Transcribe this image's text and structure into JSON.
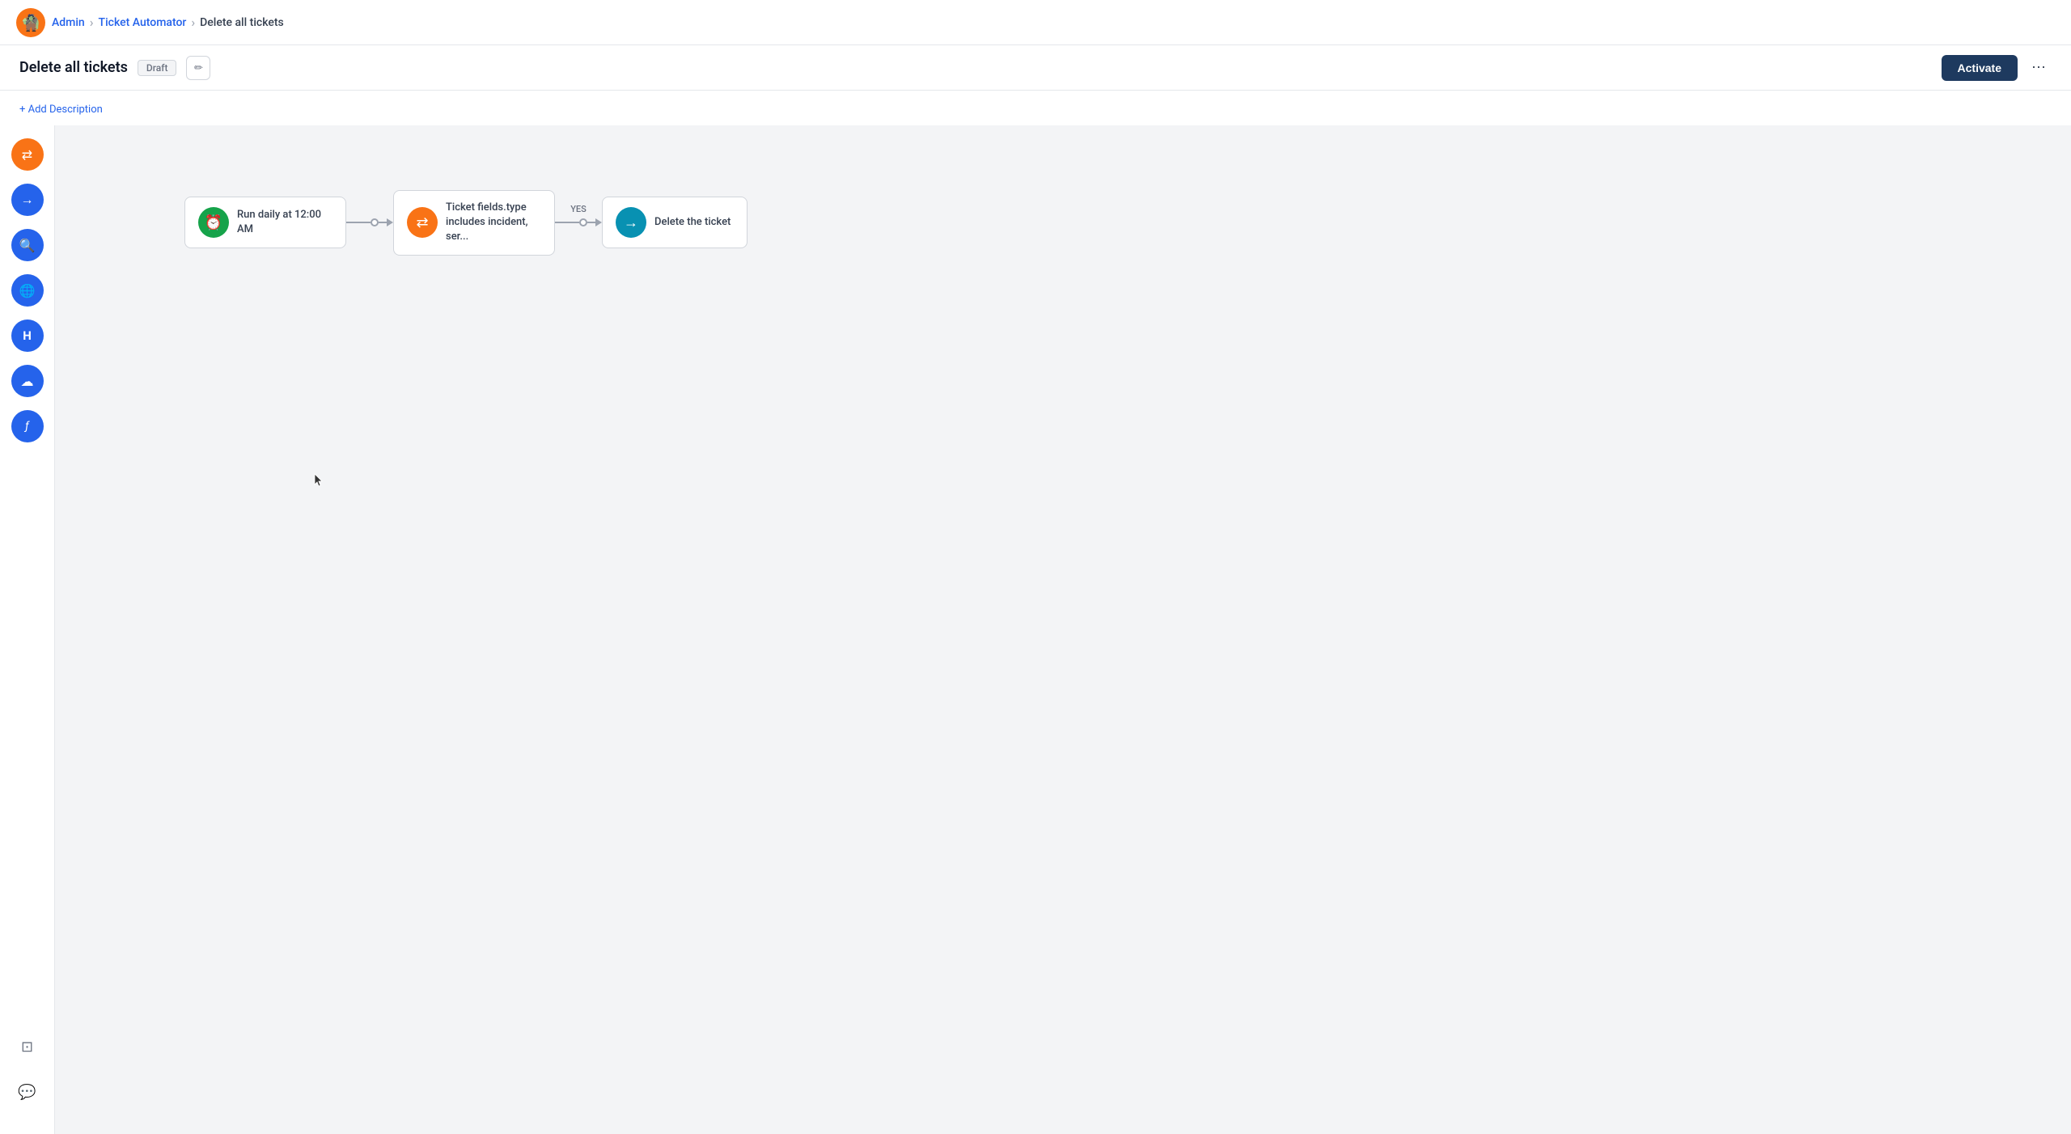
{
  "nav": {
    "admin_label": "Admin",
    "ticket_automator_label": "Ticket Automator",
    "current_label": "Delete all tickets"
  },
  "toolbar": {
    "title": "Delete all tickets",
    "draft_label": "Draft",
    "activate_label": "Activate"
  },
  "add_description": {
    "label": "+ Add Description"
  },
  "sidebar": {
    "icons": [
      {
        "name": "filter-icon",
        "symbol": "⇄",
        "color": "orange"
      },
      {
        "name": "arrow-icon",
        "symbol": "→",
        "color": "blue"
      },
      {
        "name": "search-icon",
        "symbol": "🔍",
        "color": "blue"
      },
      {
        "name": "globe-icon",
        "symbol": "🌐",
        "color": "blue"
      },
      {
        "name": "h-icon",
        "symbol": "H",
        "color": "blue"
      },
      {
        "name": "cloud-icon",
        "symbol": "☁",
        "color": "blue"
      },
      {
        "name": "function-icon",
        "symbol": "ƒ",
        "color": "blue"
      }
    ],
    "bottom_icons": [
      {
        "name": "terminal-icon",
        "symbol": "▷"
      },
      {
        "name": "chat-icon",
        "symbol": "💬"
      }
    ]
  },
  "flow": {
    "trigger": {
      "icon_symbol": "⏰",
      "icon_color": "green",
      "label": "Run daily at 12:00 AM"
    },
    "condition": {
      "icon_symbol": "⇄",
      "icon_color": "orange",
      "label": "Ticket fields.type includes incident, ser..."
    },
    "action": {
      "icon_symbol": "→",
      "icon_color": "teal",
      "label": "Delete the ticket"
    },
    "yes_label": "YES"
  }
}
